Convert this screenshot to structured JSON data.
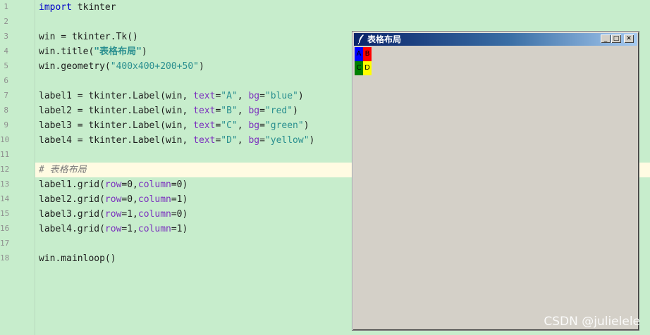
{
  "editor": {
    "line_numbers": [
      "1",
      "2",
      "3",
      "4",
      "5",
      "6",
      "7",
      "8",
      "9",
      "10",
      "11",
      "12",
      "13",
      "14",
      "15",
      "16",
      "17",
      "18"
    ],
    "code": {
      "l1_kw": "import",
      "l1_rest": " tkinter",
      "l3": "win = tkinter.Tk()",
      "l4_a": "win.title(",
      "l4_s": "\"表格布局\"",
      "l4_b": ")",
      "l5_a": "win.geometry(",
      "l5_s": "\"400x400+200+50\"",
      "l5_b": ")",
      "l7_a": "label1 = tkinter.Label(win, ",
      "l7_p1": "text",
      "l7_eq1": "=",
      "l7_s1": "\"A\"",
      "l7_c": ", ",
      "l7_p2": "bg",
      "l7_eq2": "=",
      "l7_s2": "\"blue\"",
      "l7_e": ")",
      "l8_a": "label2 = tkinter.Label(win, ",
      "l8_p1": "text",
      "l8_eq1": "=",
      "l8_s1": "\"B\"",
      "l8_c": ", ",
      "l8_p2": "bg",
      "l8_eq2": "=",
      "l8_s2": "\"red\"",
      "l8_e": ")",
      "l9_a": "label3 = tkinter.Label(win, ",
      "l9_p1": "text",
      "l9_eq1": "=",
      "l9_s1": "\"C\"",
      "l9_c": ", ",
      "l9_p2": "bg",
      "l9_eq2": "=",
      "l9_s2": "\"green\"",
      "l9_e": ")",
      "l10_a": "label4 = tkinter.Label(win, ",
      "l10_p1": "text",
      "l10_eq1": "=",
      "l10_s1": "\"D\"",
      "l10_c": ", ",
      "l10_p2": "bg",
      "l10_eq2": "=",
      "l10_s2": "\"yellow\"",
      "l10_e": ")",
      "l12": "# 表格布局",
      "l13_a": "label1.grid(",
      "l13_p1": "row",
      "l13_v1": "=0,",
      "l13_p2": "column",
      "l13_v2": "=0)",
      "l14_a": "label2.grid(",
      "l14_p1": "row",
      "l14_v1": "=0,",
      "l14_p2": "column",
      "l14_v2": "=1)",
      "l15_a": "label3.grid(",
      "l15_p1": "row",
      "l15_v1": "=1,",
      "l15_p2": "column",
      "l15_v2": "=0)",
      "l16_a": "label4.grid(",
      "l16_p1": "row",
      "l16_v1": "=1,",
      "l16_p2": "column",
      "l16_v2": "=1)",
      "l18": "win.mainloop()"
    }
  },
  "tk_window": {
    "title": "表格布局",
    "buttons": {
      "minimize": "_",
      "maximize": "□",
      "close": "✕"
    },
    "labels": {
      "a": "A",
      "b": "B",
      "c": "C",
      "d": "D"
    },
    "colors": {
      "a": "#0000ff",
      "b": "#ff0000",
      "c": "#008000",
      "d": "#ffff00"
    },
    "app_icon": "feather-icon"
  },
  "watermark": "CSDN @julielele",
  "colors": {
    "editor_bg": "#c7edcc",
    "current_line": "#fffbe2",
    "title_bar": "#0a246a"
  }
}
